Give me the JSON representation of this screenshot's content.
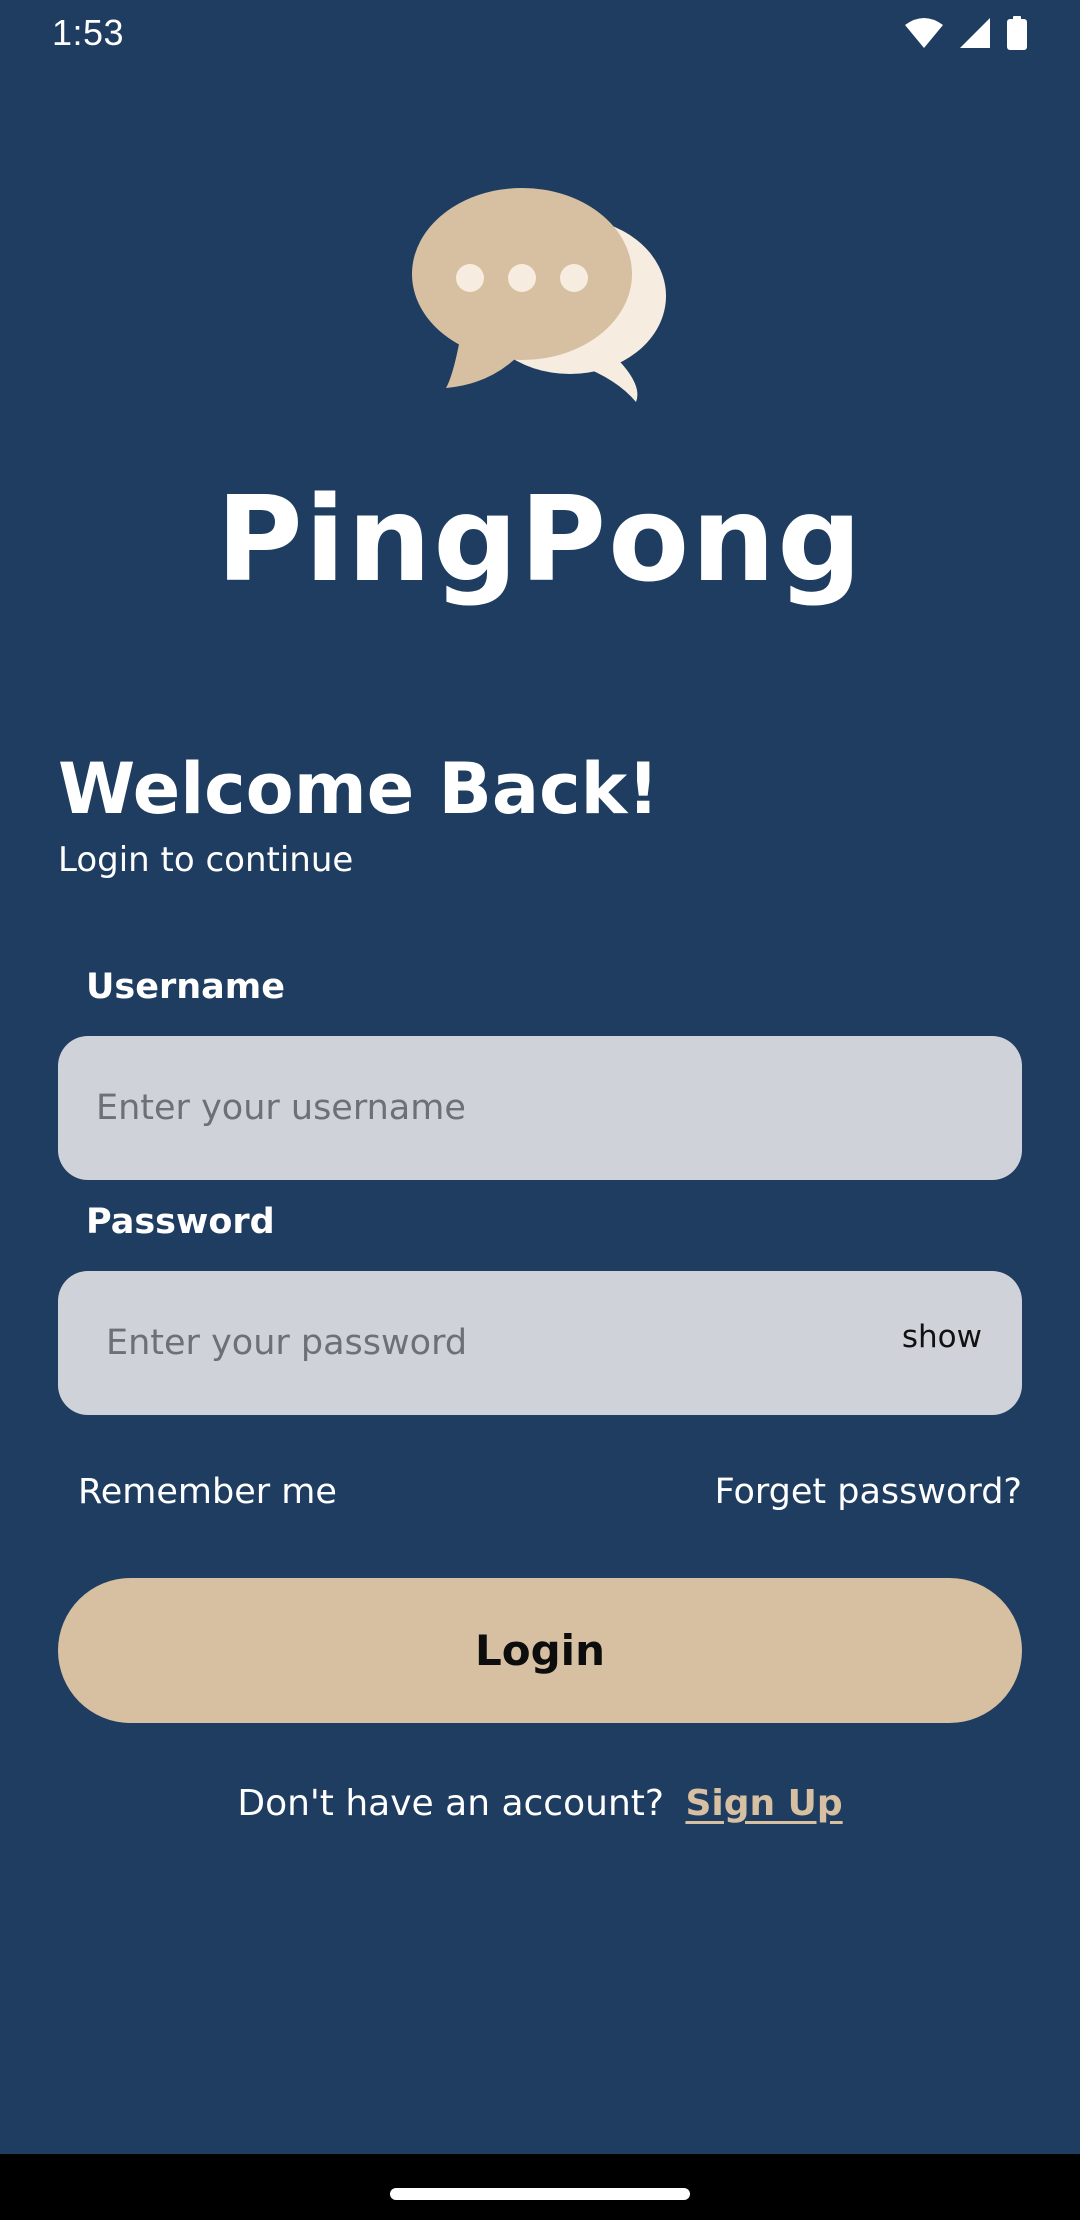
{
  "status_bar": {
    "time": "1:53",
    "icons": [
      "wifi-icon",
      "signal-icon",
      "battery-icon"
    ]
  },
  "brand": {
    "name": "PingPong",
    "logo": "chat-bubbles-icon"
  },
  "welcome": {
    "title": "Welcome Back!",
    "subtitle": "Login to continue"
  },
  "form": {
    "username": {
      "label": "Username",
      "value": "",
      "placeholder": "Enter your username"
    },
    "password": {
      "label": "Password",
      "value": "",
      "placeholder": "Enter your password",
      "toggle_label": "show"
    },
    "remember_me": "Remember me",
    "forget_password": "Forget password?",
    "login_label": "Login"
  },
  "signup": {
    "prompt": "Don't have an account?",
    "link": "Sign Up"
  },
  "colors": {
    "background": "#1f3d61",
    "accent": "#d7bfa1",
    "accent_light": "#f6ede0",
    "input_bg": "#d0d2da"
  }
}
